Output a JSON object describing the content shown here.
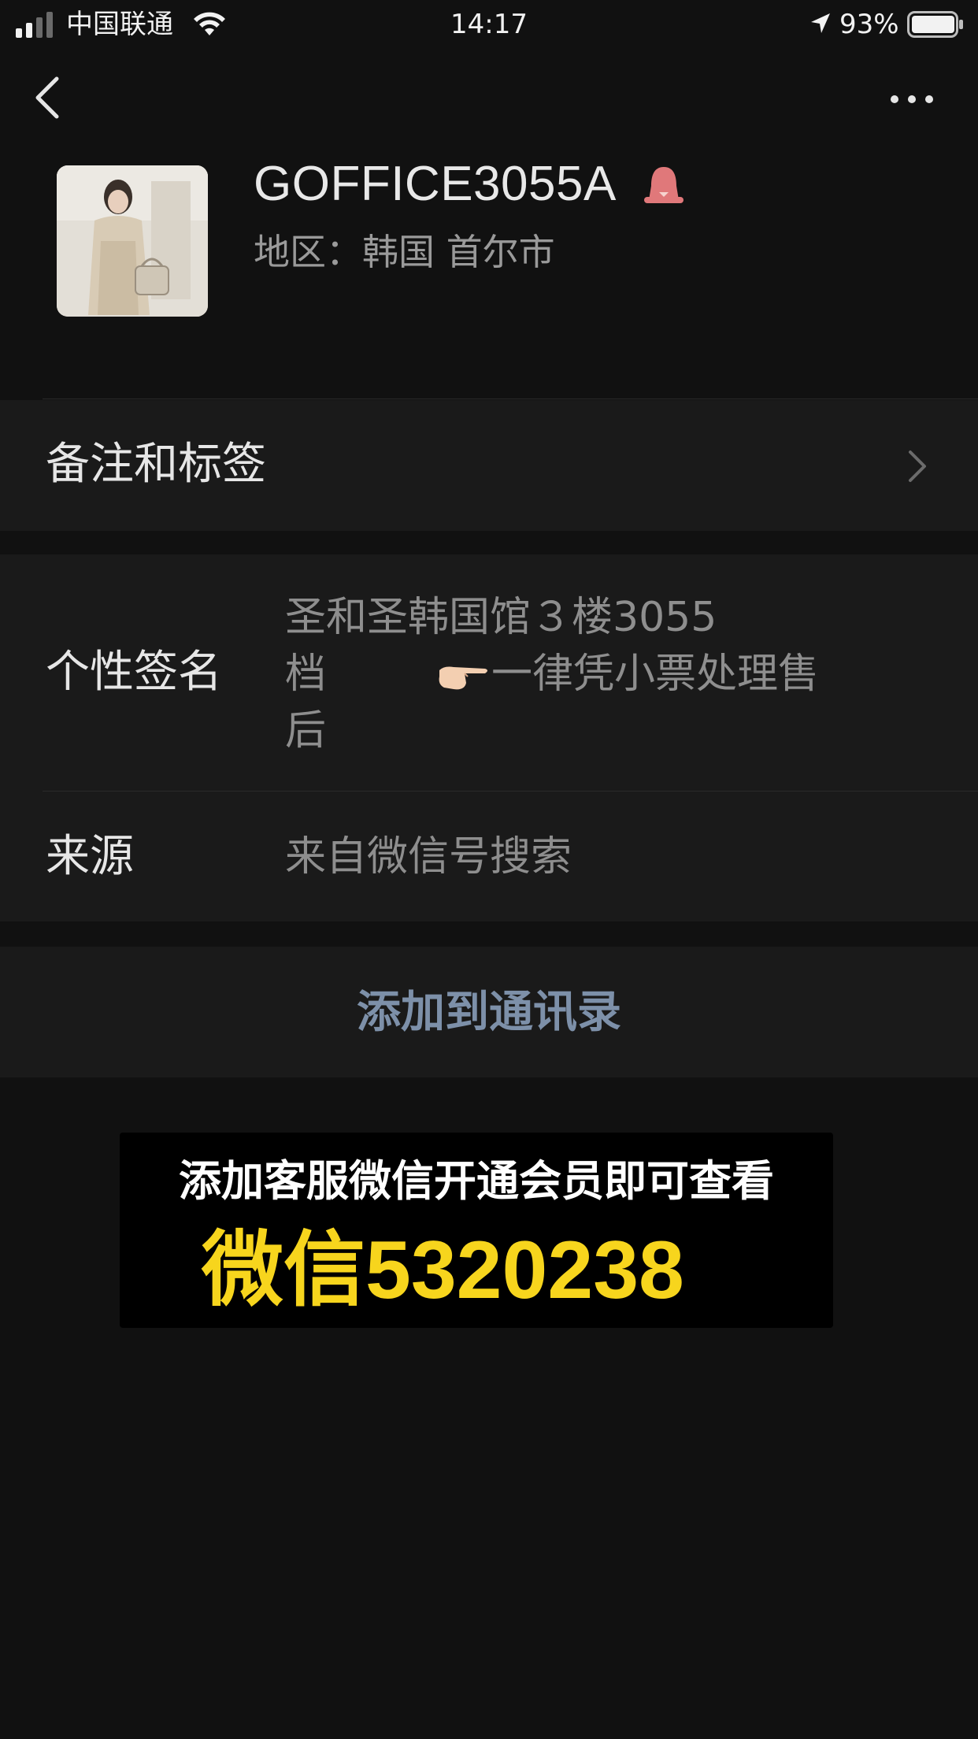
{
  "status_bar": {
    "carrier": "中国联通",
    "time": "14:17",
    "battery_percent": "93%",
    "battery_level": 0.93
  },
  "nav": {
    "back_icon": "chevron-left-icon",
    "more_icon": "more-horizontal-icon"
  },
  "profile": {
    "nickname": "GOFFICE3055A",
    "gender_icon": "female-icon",
    "region": "地区：韩国 首尔市"
  },
  "rows": {
    "remark_label": "备注和标签",
    "signature_label": "个性签名",
    "signature_value_1": "圣和圣韩国馆３楼3055",
    "signature_value_2a": "档",
    "signature_emoji": "point-right-emoji",
    "signature_value_2b": "一律凭小票处理售",
    "signature_value_3": "后",
    "source_label": "来源",
    "source_value": "来自微信号搜索"
  },
  "actions": {
    "add_contact": "添加到通讯录"
  },
  "banner": {
    "line1": "添加客服微信开通会员即可查看",
    "line2": "微信5320238"
  },
  "colors": {
    "background": "#111111",
    "row_background": "#1a1a1a",
    "link_blue": "#7d90a9",
    "banner_yellow": "#f7d51d"
  }
}
